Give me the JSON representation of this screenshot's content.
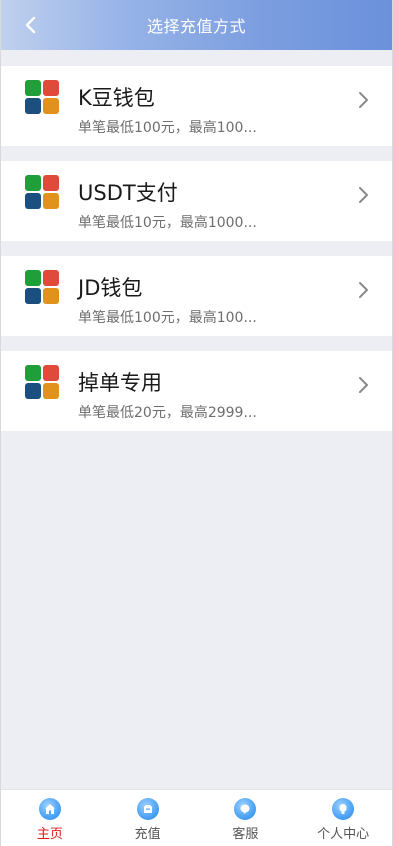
{
  "header": {
    "title": "选择充值方式",
    "back_icon": "chevron-left-icon"
  },
  "methods": [
    {
      "title": "K豆钱包",
      "desc": "单笔最低100元，最高100...",
      "icon": "app-grid-icon"
    },
    {
      "title": "USDT支付",
      "desc": "单笔最低10元，最高1000...",
      "icon": "app-grid-icon"
    },
    {
      "title": "JD钱包",
      "desc": "单笔最低100元，最高100...",
      "icon": "app-grid-icon"
    },
    {
      "title": "掉单专用",
      "desc": "单笔最低20元，最高2999...",
      "icon": "app-grid-icon"
    }
  ],
  "tabbar": {
    "items": [
      {
        "label": "主页",
        "icon": "home-icon",
        "active": true
      },
      {
        "label": "充值",
        "icon": "recharge-icon",
        "active": false
      },
      {
        "label": "客服",
        "icon": "customer-service-icon",
        "active": false
      },
      {
        "label": "个人中心",
        "icon": "profile-icon",
        "active": false
      }
    ]
  },
  "colors": {
    "header_gradient_start": "#c0d0ee",
    "header_gradient_end": "#6b91dc",
    "background": "#edeef3",
    "active_tab": "#e01818",
    "tile_green": "#1f9e3a",
    "tile_red": "#e04a3a",
    "tile_navy": "#1b4f80",
    "tile_orange": "#e0921c"
  }
}
